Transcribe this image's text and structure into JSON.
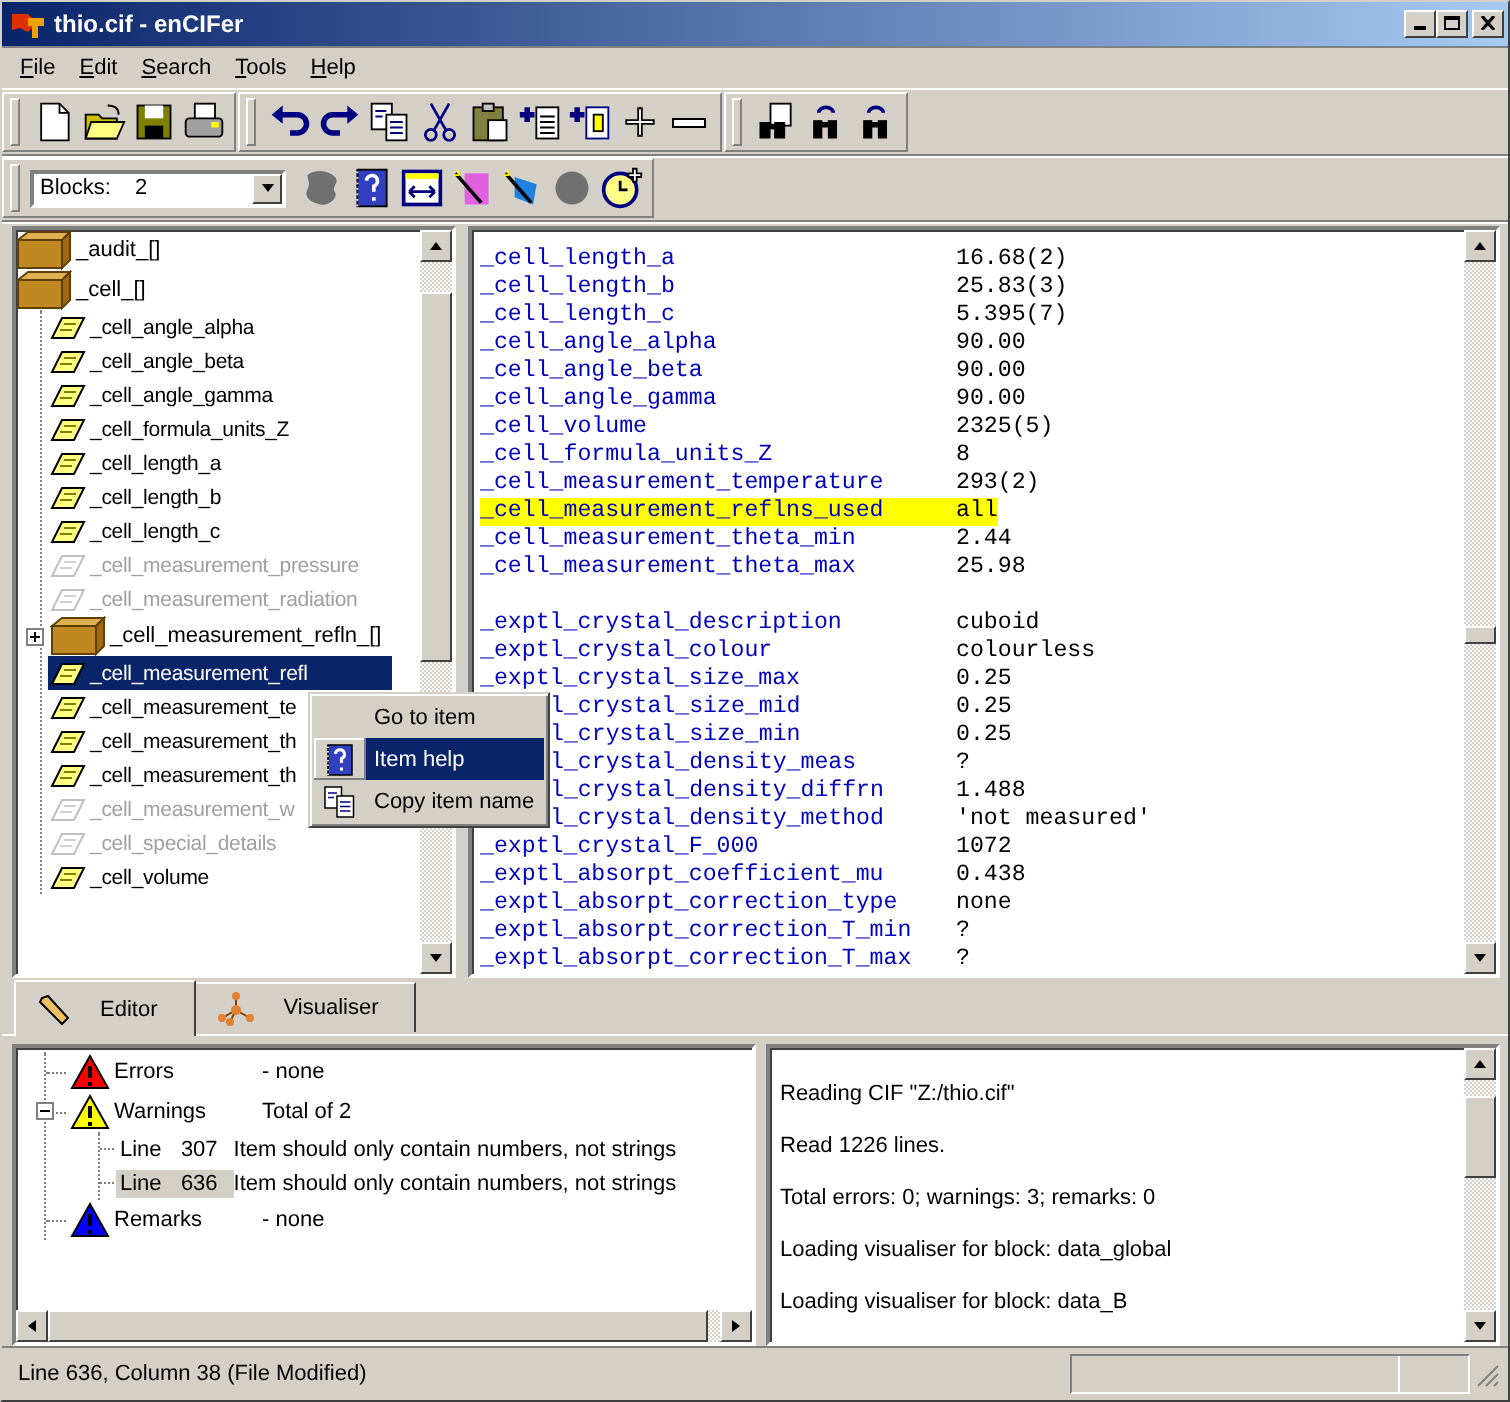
{
  "window": {
    "title": "thio.cif - enCIFer"
  },
  "menu": [
    "File",
    "Edit",
    "Search",
    "Tools",
    "Help"
  ],
  "blocks_selector": {
    "label": "Blocks:",
    "value": "2"
  },
  "tree": [
    {
      "kind": "category",
      "label": "_audit_[]"
    },
    {
      "kind": "category",
      "label": "_cell_[]",
      "children": [
        {
          "kind": "item",
          "label": "_cell_angle_alpha",
          "disabled": false,
          "selected": false
        },
        {
          "kind": "item",
          "label": "_cell_angle_beta",
          "disabled": false,
          "selected": false
        },
        {
          "kind": "item",
          "label": "_cell_angle_gamma",
          "disabled": false,
          "selected": false
        },
        {
          "kind": "item",
          "label": "_cell_formula_units_Z",
          "disabled": false,
          "selected": false
        },
        {
          "kind": "item",
          "label": "_cell_length_a",
          "disabled": false,
          "selected": false
        },
        {
          "kind": "item",
          "label": "_cell_length_b",
          "disabled": false,
          "selected": false
        },
        {
          "kind": "item",
          "label": "_cell_length_c",
          "disabled": false,
          "selected": false
        },
        {
          "kind": "item",
          "label": "_cell_measurement_pressure",
          "disabled": true,
          "selected": false
        },
        {
          "kind": "item",
          "label": "_cell_measurement_radiation",
          "disabled": true,
          "selected": false
        },
        {
          "kind": "category",
          "label": "_cell_measurement_refln_[]",
          "expanded": false
        },
        {
          "kind": "item",
          "label": "_cell_measurement_refl",
          "disabled": false,
          "selected": true
        },
        {
          "kind": "item",
          "label": "_cell_measurement_te",
          "disabled": false,
          "selected": false
        },
        {
          "kind": "item",
          "label": "_cell_measurement_th",
          "disabled": false,
          "selected": false
        },
        {
          "kind": "item",
          "label": "_cell_measurement_th",
          "disabled": false,
          "selected": false
        },
        {
          "kind": "item",
          "label": "_cell_measurement_w",
          "disabled": true,
          "selected": false
        },
        {
          "kind": "item",
          "label": "_cell_special_details",
          "disabled": true,
          "selected": false
        },
        {
          "kind": "item",
          "label": "_cell_volume",
          "disabled": false,
          "selected": false
        }
      ]
    }
  ],
  "context_menu": [
    {
      "kind": "plain",
      "label": "Go to item",
      "selected": false
    },
    {
      "kind": "help",
      "label": "Item help",
      "selected": true
    },
    {
      "kind": "copy",
      "label": "Copy item name",
      "selected": false
    }
  ],
  "code": {
    "groups": [
      [
        {
          "name": "_cell_length_a",
          "value": "16.68(2)",
          "highlighted": false,
          "covered": false
        },
        {
          "name": "_cell_length_b",
          "value": "25.83(3)",
          "highlighted": false,
          "covered": false
        },
        {
          "name": "_cell_length_c",
          "value": "5.395(7)",
          "highlighted": false,
          "covered": false
        },
        {
          "name": "_cell_angle_alpha",
          "value": "90.00",
          "highlighted": false,
          "covered": false
        },
        {
          "name": "_cell_angle_beta",
          "value": "90.00",
          "highlighted": false,
          "covered": false
        },
        {
          "name": "_cell_angle_gamma",
          "value": "90.00",
          "highlighted": false,
          "covered": false
        },
        {
          "name": "_cell_volume",
          "value": "2325(5)",
          "highlighted": false,
          "covered": false
        },
        {
          "name": "_cell_formula_units_Z",
          "value": "8",
          "highlighted": false,
          "covered": false
        },
        {
          "name": "_cell_measurement_temperature",
          "value": "293(2)",
          "highlighted": false,
          "covered": false
        },
        {
          "name": "_cell_measurement_reflns_used",
          "value": "all",
          "highlighted": true,
          "covered": false
        },
        {
          "name": "_cell_measurement_theta_min",
          "value": "2.44",
          "highlighted": false,
          "covered": false
        },
        {
          "name": "_cell_measurement_theta_max",
          "value": "25.98",
          "highlighted": false,
          "covered": false
        }
      ],
      [
        {
          "name": "_exptl_crystal_description",
          "value": "cuboid",
          "highlighted": false,
          "covered": false
        },
        {
          "name": "_exptl_crystal_colour",
          "value": "colourless",
          "highlighted": false,
          "covered": false
        },
        {
          "name": "_exptl_crystal_size_max",
          "value": "0.25",
          "highlighted": false,
          "covered": false
        },
        {
          "name": "l_crystal_size_mid",
          "value": "0.25",
          "highlighted": false,
          "covered": true
        },
        {
          "name": "l_crystal_size_min",
          "value": "0.25",
          "highlighted": false,
          "covered": true
        },
        {
          "name": "l_crystal_density_meas",
          "value": "?",
          "highlighted": false,
          "covered": true
        },
        {
          "name": "l_crystal_density_diffrn",
          "value": "1.488",
          "highlighted": false,
          "covered": true
        },
        {
          "name": "l_crystal_density_method",
          "value": "'not measured'",
          "highlighted": false,
          "covered": true
        },
        {
          "name": "_exptl_crystal_F_000",
          "value": "1072",
          "highlighted": false,
          "covered": false
        },
        {
          "name": "_exptl_absorpt_coefficient_mu",
          "value": "0.438",
          "highlighted": false,
          "covered": false
        },
        {
          "name": "_exptl_absorpt_correction_type",
          "value": "none",
          "highlighted": false,
          "covered": false
        },
        {
          "name": "_exptl_absorpt_correction_T_min",
          "value": "?",
          "highlighted": false,
          "covered": false
        },
        {
          "name": "_exptl_absorpt_correction_T_max",
          "value": "?",
          "highlighted": false,
          "covered": false
        }
      ]
    ]
  },
  "tabs": [
    {
      "kind": "pencil",
      "label": "Editor",
      "selected": true
    },
    {
      "kind": "molecule",
      "label": "Visualiser",
      "selected": false
    }
  ],
  "messages": [
    {
      "label": "Errors",
      "detail": "- none",
      "color": "#ff0000"
    },
    {
      "label": "Warnings",
      "detail": "Total of 2",
      "color": "#ffff00",
      "expanded": true,
      "children": [
        {
          "label": "Line",
          "number": "307",
          "text": "Item should only contain numbers, not strings",
          "selected": false
        },
        {
          "label": "Line",
          "number": "636",
          "text": "Item should only contain numbers, not strings",
          "selected": true
        }
      ]
    },
    {
      "label": "Remarks",
      "detail": "- none",
      "color": "#0000ff"
    }
  ],
  "log": [
    "Reading CIF \"Z:/thio.cif\"",
    "Read 1226 lines.",
    "Total errors: 0; warnings: 3; remarks: 0",
    "Loading visualiser for block: data_global",
    "Loading visualiser for block: data_B"
  ],
  "status_bar": {
    "text": "Line 636, Column 38 (File Modified)"
  }
}
